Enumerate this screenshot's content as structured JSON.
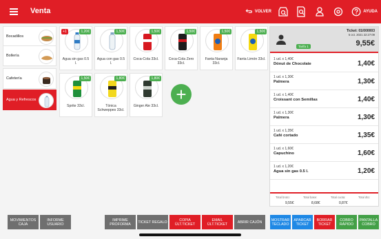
{
  "header": {
    "title": "Venta",
    "volver": "VOLVER",
    "ayuda": "AYUDA",
    "icons": [
      "menu-icon",
      "return-arrow-icon",
      "search-product-icon",
      "search-ticket-icon",
      "user-icon",
      "settings-icon",
      "help-icon"
    ]
  },
  "categories": [
    {
      "label": "Bocadillos"
    },
    {
      "label": "Bollería"
    },
    {
      "label": "Cafetería"
    },
    {
      "label": "Agua y Refrescos"
    }
  ],
  "products": [
    {
      "name": "Agua sin gas 0.5 l.",
      "price": "1,20€",
      "qty": "+1"
    },
    {
      "name": "Agua con gas 0.5 l.",
      "price": "1,50€"
    },
    {
      "name": "Coca-Cola 33cl.",
      "price": "1,50€"
    },
    {
      "name": "Coca-Cola Zero 33cl.",
      "price": "1,50€"
    },
    {
      "name": "Fanta Naranja 33cl.",
      "price": "1,50€"
    },
    {
      "name": "Fanta Limón 33cl.",
      "price": "1,50€"
    },
    {
      "name": "Sprite 33cl.",
      "price": "1,50€"
    },
    {
      "name": "Tónica Schweppes 33cl.",
      "price": "1,80€"
    },
    {
      "name": "Ginger Ale 33cl.",
      "price": "1,80€"
    }
  ],
  "ticket": {
    "number": "Ticket: 01/000003",
    "date": "5 oct. 2021 22:27:09",
    "total": "9,55€",
    "tarifa": "Tarifa 1",
    "lines": [
      {
        "qty": "1 ud. x 1,40€",
        "name": "Dónut de Chocolate",
        "total": "1,40€"
      },
      {
        "qty": "1 ud. x 1,30€",
        "name": "Palmera",
        "total": "1,30€"
      },
      {
        "qty": "1 ud. x 1,40€",
        "name": "Croissant con Semillas",
        "total": "1,40€"
      },
      {
        "qty": "1 ud. x 1,30€",
        "name": "Palmera",
        "total": "1,30€"
      },
      {
        "qty": "1 ud. x 1,35€",
        "name": "Café cortado",
        "total": "1,35€"
      },
      {
        "qty": "1 ud. x 1,60€",
        "name": "Capuchino",
        "total": "1,60€"
      },
      {
        "qty": "1 ud. x 1,20€",
        "name": "Agua sin gas 0.5 l.",
        "total": "1,20€"
      }
    ],
    "footer": {
      "bruto_label": "Total bruto:",
      "bruto": "9,55€",
      "base_label": "Total base:",
      "base": "8,68€",
      "cuota_label": "Total cuota:",
      "cuota": "0,87€",
      "dto_label": "Total dto:",
      "dto": ""
    }
  },
  "actions": {
    "movimientos": "MOVIMIENTOS CAJA",
    "informe": "INFORME USUARIO",
    "imprime": "IMPRIME PROFORMA",
    "regalo": "TICKET REGALO",
    "copia": "COPIA ÚLT.TICKET",
    "email": "EMAIL ÚLT.TICKET",
    "abrir": "ABRIR CAJÓN",
    "teclado": "MOSTRAR TECLADO",
    "aparcar": "APARCAR TICKET",
    "borrar": "BORRAR TICKET",
    "cobro_rapido": "COBRO RÁPIDO",
    "pantalla_cobro": "PANTALLA COBRO"
  },
  "colors": {
    "brand": "#e01e26",
    "price_tag": "#4caf50",
    "blue": "#1e88e5",
    "green": "#43a047",
    "gray": "#6f6f6f"
  }
}
